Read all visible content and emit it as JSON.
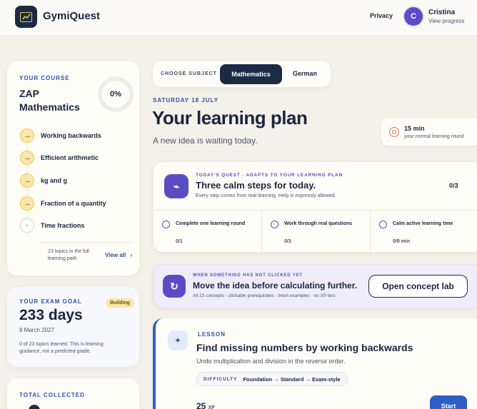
{
  "header": {
    "brand": "GymiQuest",
    "privacy": "Privacy",
    "user_initial": "C",
    "user_name": "Cristina",
    "user_sub": "View progress"
  },
  "course": {
    "eyebrow": "YOUR COURSE",
    "title": "ZAP Mathematics",
    "progress": "0%",
    "topics": [
      {
        "label": "Working backwards",
        "status": "active",
        "icon": "→"
      },
      {
        "label": "Efficient arithmetic",
        "status": "active",
        "icon": "→"
      },
      {
        "label": "kg and g",
        "status": "active",
        "icon": "→"
      },
      {
        "label": "Fraction of a quantity",
        "status": "active",
        "icon": "→"
      },
      {
        "label": "Time fractions",
        "status": "pending",
        "icon": "•"
      }
    ],
    "footer_note": "23 topics in the full learning path",
    "view_all": "View all",
    "view_all_chevron": "›"
  },
  "exam": {
    "eyebrow": "YOUR EXAM GOAL",
    "badge": "Building",
    "days": "233 days",
    "date": "8 March 2027",
    "note": "0 of 23 topics learned. This is learning guidance, not a predicted grade."
  },
  "total": {
    "eyebrow": "TOTAL COLLECTED"
  },
  "subject": {
    "label": "CHOOSE SUBJECT",
    "active": "Mathematics",
    "other": "German"
  },
  "plan": {
    "date": "SATURDAY 18 JULY",
    "title": "Your learning plan",
    "subtitle": "A new idea is waiting today.",
    "minutes": "15 min",
    "minutes_sub": "your normal learning round"
  },
  "quest": {
    "icon": "⌁",
    "eyebrow": "TODAY'S QUEST · ADAPTS TO YOUR LEARNING PLAN",
    "title": "Three calm steps for today.",
    "subtitle": "Every step comes from real learning. Help is expressly allowed.",
    "count": "0/3",
    "steps": [
      {
        "title": "Complete one learning round",
        "progress": "0/1"
      },
      {
        "title": "Work through real questions",
        "progress": "0/3"
      },
      {
        "title": "Calm active learning time",
        "progress": "0/9 min"
      }
    ]
  },
  "lab": {
    "icon": "↻",
    "eyebrow": "WHEN SOMETHING HAS NOT CLICKED YET",
    "title": "Move the idea before calculating further.",
    "subtitle": "All 23 concepts · clickable prerequisites · fresh examples · no XP test",
    "button": "Open concept lab"
  },
  "lesson": {
    "icon": "✦",
    "eyebrow": "LESSON",
    "title": "Find missing numbers by working backwards",
    "subtitle": "Undo multiplication and division in the reverse order.",
    "difficulty_label": "DIFFICULTY",
    "difficulty_value": "Foundation → Standard → Exam-style",
    "xp_value": "25",
    "xp_unit": "XP",
    "start": "Start"
  }
}
